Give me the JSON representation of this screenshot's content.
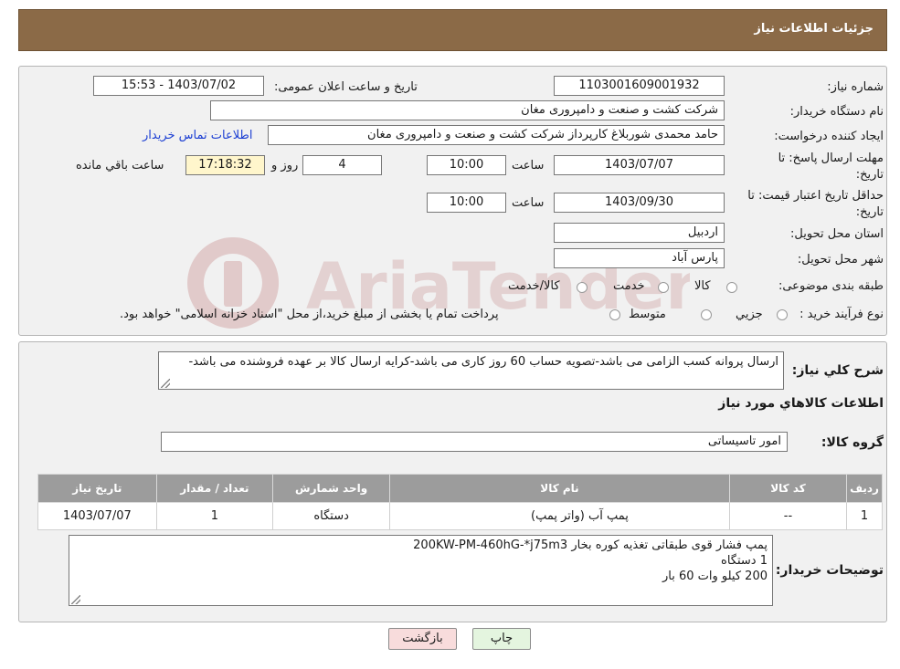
{
  "header": {
    "title": "جزئیات اطلاعات نیاز"
  },
  "form": {
    "need_number_label": "شماره نیاز:",
    "need_number": "1103001609001932",
    "announce_label": "تاریخ و ساعت اعلان عمومی:",
    "announce_value": "1403/07/02 - 15:53",
    "buyer_label": "نام دستگاه خریدار:",
    "buyer_value": "شرکت کشت و صنعت و دامپروری مغان",
    "creator_label": "ایجاد کننده درخواست:",
    "creator_value": "حامد محمدی شوربلاغ کارپرداز شرکت کشت و صنعت و دامپروری مغان",
    "contact_link": "اطلاعات تماس خریدار",
    "reply_label_1": "مهلت ارسال پاسخ: تا",
    "reply_label_2": "تاریخ:",
    "reply_date": "1403/07/07",
    "time_label": "ساعت",
    "reply_time": "10:00",
    "days_value": "4",
    "days_label": "روز و",
    "remaining_time": "17:18:32",
    "remaining_label": "ساعت باقي مانده",
    "price_label_1": "حداقل تاریخ اعتبار قیمت: تا",
    "price_label_2": "تاریخ:",
    "price_date": "1403/09/30",
    "price_time": "10:00",
    "province_label": "استان محل تحویل:",
    "province_value": "اردبیل",
    "city_label": "شهر محل تحویل:",
    "city_value": "پارس آباد",
    "category_label": "طبقه بندی موضوعی:",
    "category_options": [
      "کالا",
      "خدمت",
      "کالا/خدمت"
    ],
    "process_label": "نوع فرآیند خرید :",
    "process_options": [
      "جزیي",
      "متوسط"
    ],
    "process_note": "پرداخت تمام یا بخشی از مبلغ خرید،از محل \"اسناد خزانه اسلامی\" خواهد بود."
  },
  "description": {
    "label": "شرح کلي نياز:",
    "text": "ارسال پروانه کسب الزامی می باشد-تصویه حساب 60 روز کاری می باشد-کرایه ارسال کالا بر عهده فروشنده می باشد-",
    "goods_title": "اطلاعات کالاهاي مورد نياز",
    "group_label": "گروه کالا:",
    "group_value": "امور تاسیساتی"
  },
  "table": {
    "headers": [
      "رديف",
      "کد کالا",
      "نام کالا",
      "واحد شمارش",
      "تعداد / مقدار",
      "تاریخ نیاز"
    ],
    "rows": [
      [
        "1",
        "--",
        "پمپ آب (واتر پمپ)",
        "دستگاه",
        "1",
        "1403/07/07"
      ]
    ]
  },
  "buyer_notes": {
    "label": "توضیحات خریدار:",
    "line1": "پمپ فشار قوی طبقاتی تغذیه کوره بخار 200KW-PM-460hG-*j75m3",
    "line2": "1 دستگاه",
    "line3": "200 کیلو وات 60 بار"
  },
  "buttons": {
    "print": "چاپ",
    "back": "بازگشت"
  },
  "watermark": {
    "text": "AriaTender.neT"
  },
  "colors": {
    "header_bg": "#8b6a47",
    "link": "#1c3fd3",
    "back_button_bg": "#f8dcdc",
    "print_button_bg": "#e4f5df"
  }
}
